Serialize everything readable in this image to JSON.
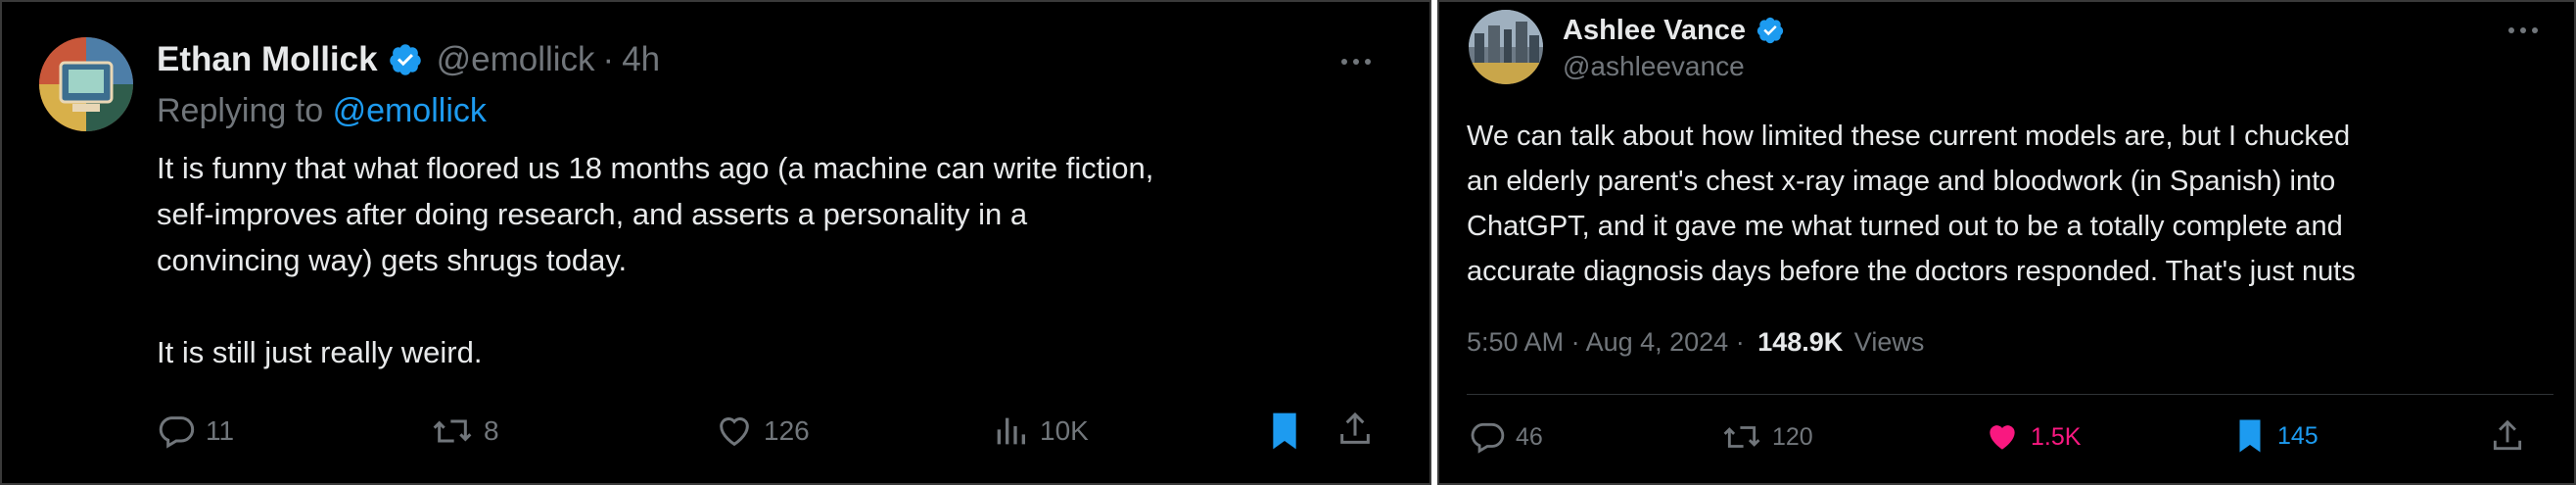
{
  "colors": {
    "background": "#000000",
    "text": "#e7e9ea",
    "muted": "#71767b",
    "link": "#1d9bf0",
    "like_active": "#f91880",
    "bookmark_active": "#1d9bf0"
  },
  "left_tweet": {
    "author_name": "Ethan Mollick",
    "handle": "@emollick",
    "separator": "·",
    "time": "4h",
    "reply_prefix": "Replying to",
    "reply_target": "@emollick",
    "text": "It is funny that what floored us 18 months ago (a machine can write fiction,\nself-improves after doing research, and asserts a personality in a\nconvincing way) gets shrugs today.\n\nIt is still just really weird.",
    "actions": {
      "reply_count": "11",
      "repost_count": "8",
      "like_count": "126",
      "views_count": "10K"
    },
    "icons": [
      "avatar",
      "verified-icon",
      "more-icon",
      "reply-icon",
      "repost-icon",
      "like-icon",
      "views-icon",
      "bookmark-icon",
      "share-icon"
    ]
  },
  "right_tweet": {
    "author_name": "Ashlee Vance",
    "handle": "@ashleevance",
    "text": "We can talk about how limited these current models are, but I chucked\nan elderly parent's chest x-ray image and bloodwork (in Spanish) into\nChatGPT, and it gave me what turned out to be a totally complete and\naccurate diagnosis days before the doctors responded. That's just nuts",
    "timestamp": "5:50 AM · Aug 4, 2024 ·",
    "views_count": "148.9K",
    "views_label": "Views",
    "actions": {
      "reply_count": "46",
      "repost_count": "120",
      "like_count": "1.5K",
      "bookmark_count": "145"
    },
    "icons": [
      "avatar",
      "verified-icon",
      "more-icon",
      "reply-icon",
      "repost-icon",
      "like-icon",
      "bookmark-icon",
      "share-icon"
    ]
  }
}
